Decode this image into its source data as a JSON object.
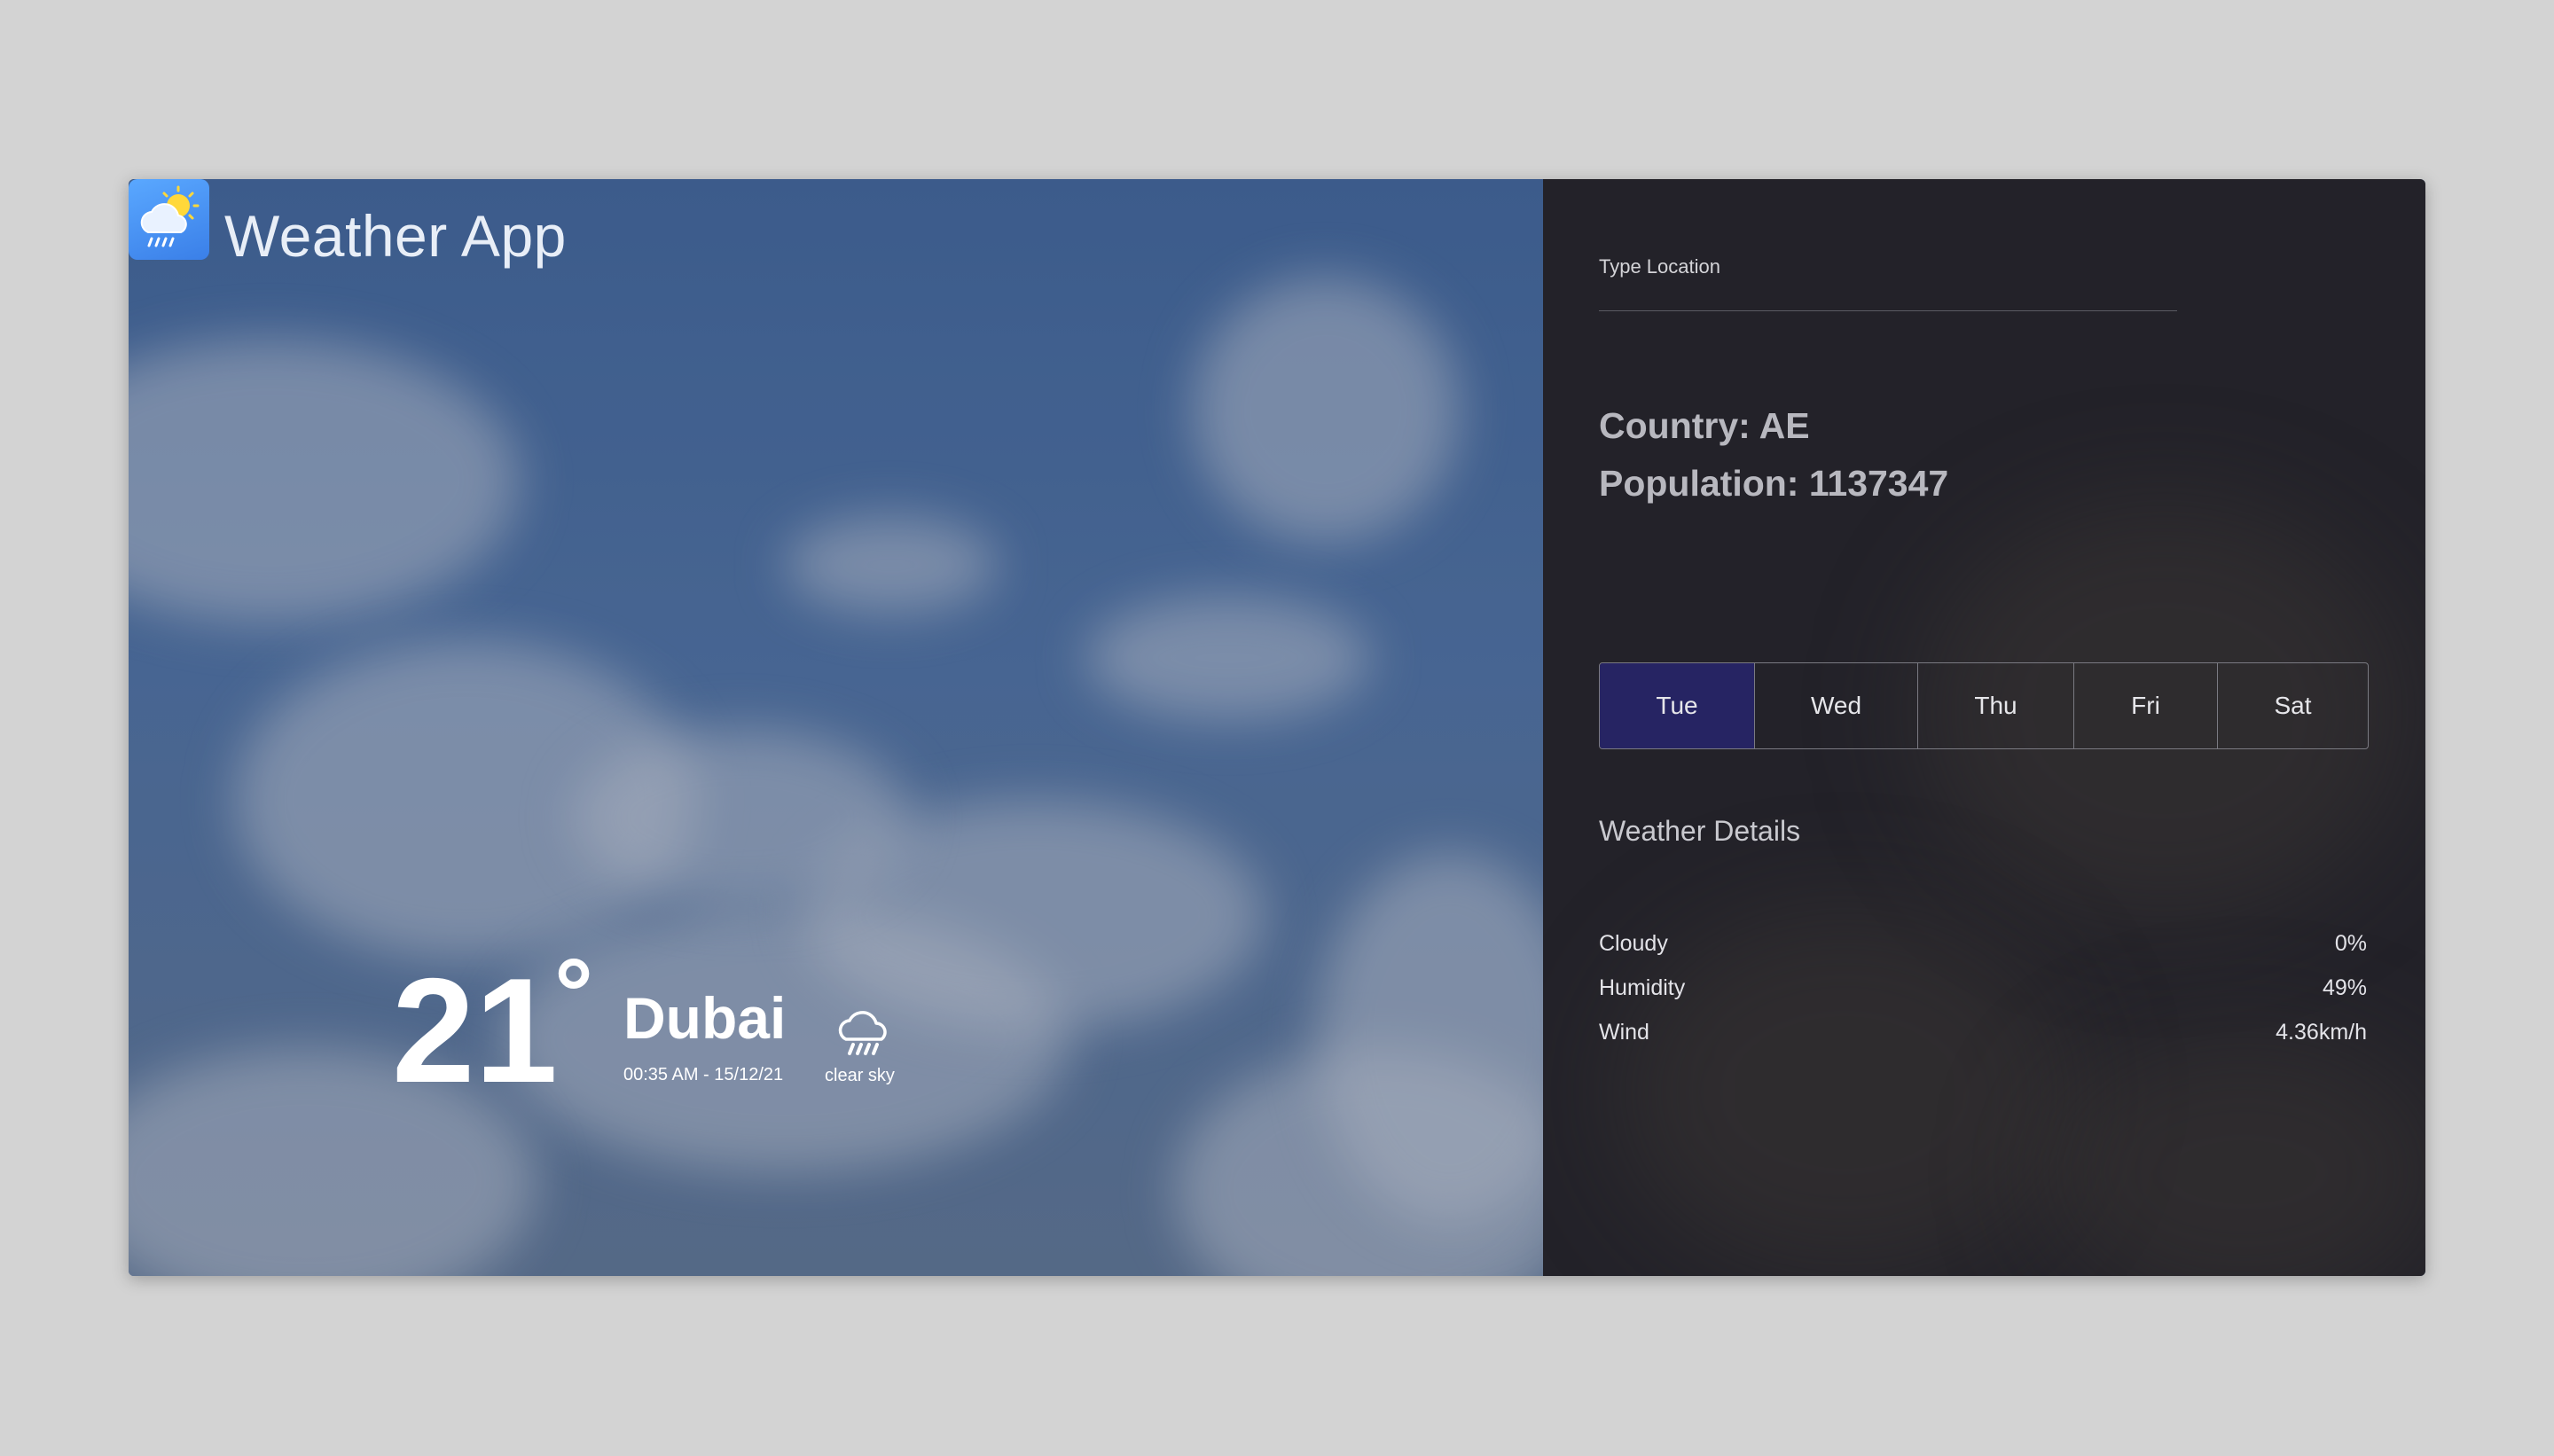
{
  "app": {
    "title": "Weather App",
    "icon": "cloud-sun-rain-icon"
  },
  "current": {
    "temperature": "21",
    "degree_symbol": "°",
    "city": "Dubai",
    "datetime": "00:35 AM - 15/12/21",
    "condition": "clear sky",
    "condition_icon": "cloud-rain-icon"
  },
  "search": {
    "label": "Type Location",
    "value": "",
    "button_icon": "search-icon",
    "button_color": "#232389"
  },
  "location": {
    "country": "Country: AE",
    "population": "Population: 1137347"
  },
  "days": {
    "tabs": [
      {
        "label": "Tue",
        "active": true
      },
      {
        "label": "Wed",
        "active": false
      },
      {
        "label": "Thu",
        "active": false
      },
      {
        "label": "Fri",
        "active": false
      },
      {
        "label": "Sat",
        "active": false
      }
    ],
    "active_color": "#262463"
  },
  "details": {
    "title": "Weather Details",
    "rows": [
      {
        "label": "Cloudy",
        "value": "0%"
      },
      {
        "label": "Humidity",
        "value": "49%"
      },
      {
        "label": "Wind",
        "value": "4.36km/h"
      }
    ]
  }
}
